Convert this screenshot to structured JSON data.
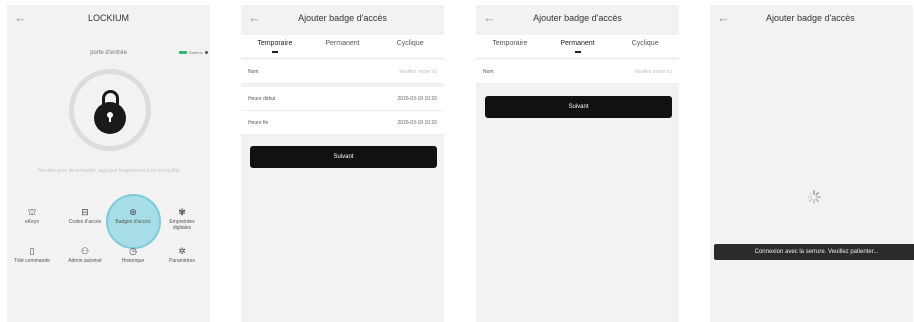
{
  "panel1": {
    "title": "LOCKIUM",
    "lock_name": "porte d'entrée",
    "battery_text": "Batterie",
    "hint": "Touchez pour déverrouiller, appuyez longuement pour verrouiller",
    "grid": [
      {
        "icon": "⛫",
        "label": "eKeys"
      },
      {
        "icon": "⊟",
        "label": "Codes d'accès"
      },
      {
        "icon": "⊛",
        "label": "Badges d'accès"
      },
      {
        "icon": "✾",
        "label": "Empreintes digitales"
      },
      {
        "icon": "▯",
        "label": "Télé commande"
      },
      {
        "icon": "⚇",
        "label": "Admin autorisé"
      },
      {
        "icon": "◷",
        "label": "Historique"
      },
      {
        "icon": "✲",
        "label": "Paramètres"
      }
    ]
  },
  "panel2": {
    "title": "Ajouter badge d'accès",
    "tabs": [
      "Temporaire",
      "Permanent",
      "Cyclique"
    ],
    "rows": [
      {
        "key": "Nom",
        "value": "Veuillez entrer ici"
      },
      {
        "key": "Heure début",
        "value": "2026-03-18 10:20"
      },
      {
        "key": "Heure fin",
        "value": "2026-03-18 10:20"
      }
    ],
    "button": "Suivant"
  },
  "panel3": {
    "title": "Ajouter badge d'accès",
    "tabs": [
      "Temporaire",
      "Permanent",
      "Cyclique"
    ],
    "rows": [
      {
        "key": "Nom",
        "value": "Veuillez entrer ici"
      }
    ],
    "button": "Suivant"
  },
  "panel4": {
    "title": "Ajouter badge d'accès",
    "toast": "Connexion avec la serrure. Veuillez patienter..."
  },
  "colors": {
    "background": "#f2f2f2",
    "button": "#111111",
    "highlight": "#a7dde6",
    "battery": "#2bb673"
  }
}
